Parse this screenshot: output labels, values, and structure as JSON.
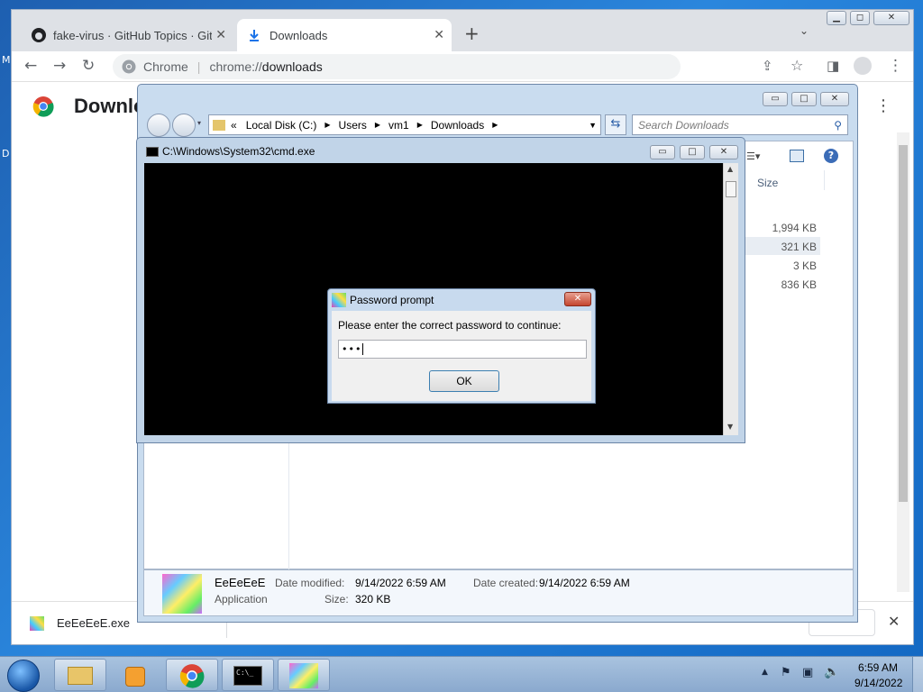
{
  "desktop": {
    "left_label_1": "M",
    "left_label_2": "D"
  },
  "chrome": {
    "tabs": [
      {
        "title": "fake-virus · GitHub Topics · GitHub",
        "icon": "github-icon"
      },
      {
        "title": "Downloads",
        "icon": "download-icon"
      }
    ],
    "new_tab_symbol": "+",
    "omnibox": {
      "site_label": "Chrome",
      "url_prefix": "chrome://",
      "url_path": "downloads"
    },
    "page_title": "Downloads",
    "download_bar": {
      "file_name": "EeEeEeE.exe"
    },
    "window_controls": {
      "minimize": "▭",
      "maximize": "□",
      "close": "✕"
    }
  },
  "explorer": {
    "breadcrumb": {
      "prefix": "«",
      "items": [
        "Local Disk (C:)",
        "Users",
        "vm1",
        "Downloads"
      ]
    },
    "search_placeholder": "Search Downloads",
    "column_size": "Size",
    "sizes": [
      "1,994 KB",
      "321 KB",
      "3 KB",
      "836 KB"
    ],
    "details": {
      "file_name": "EeEeEeE",
      "file_type": "Application",
      "modified_label": "Date modified:",
      "modified_value": "9/14/2022 6:59 AM",
      "size_label": "Size:",
      "size_value": "320 KB",
      "created_label": "Date created:",
      "created_value": "9/14/2022 6:59 AM"
    }
  },
  "cmd": {
    "title": "C:\\Windows\\System32\\cmd.exe"
  },
  "dialog": {
    "title": "Password prompt",
    "message": "Please enter the correct password to continue:",
    "password_value": "•••",
    "ok_label": "OK",
    "close_symbol": "✕"
  },
  "taskbar": {
    "time": "6:59 AM",
    "date": "9/14/2022",
    "cmd_icon_text": "C:\\_"
  },
  "colors": {
    "desktop": "#1e6fc8",
    "chrome_tabstrip": "#dee1e6",
    "cmd_bg": "#000000",
    "dialog_bg": "#f0f0f0"
  }
}
